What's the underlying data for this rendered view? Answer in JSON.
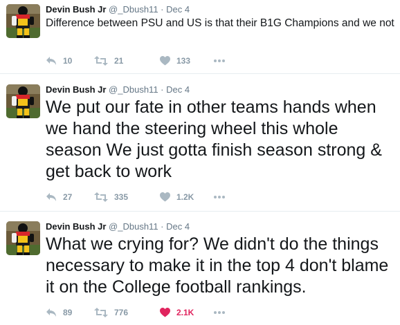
{
  "colors": {
    "text": "#14171a",
    "muted": "#657786",
    "icon": "#aab8c2",
    "like_active": "#e0245e",
    "divider": "#e6ecf0"
  },
  "tweets": [
    {
      "name": "Devin Bush Jr",
      "handle": "@_Dbush11",
      "separator": "·",
      "date": "Dec 4",
      "text": "Difference between PSU and US is that their B1G Champions and we not",
      "size": "small",
      "replies": "10",
      "retweets": "21",
      "likes": "133",
      "liked": false,
      "icons": [
        "reply-icon",
        "retweet-icon",
        "heart-icon",
        "more-icon"
      ]
    },
    {
      "name": "Devin Bush Jr",
      "handle": "@_Dbush11",
      "separator": "·",
      "date": "Dec 4",
      "text": "We put our fate in other teams hands when we hand the steering wheel this whole season We just gotta finish season strong & get back to work",
      "size": "large",
      "replies": "27",
      "retweets": "335",
      "likes": "1.2K",
      "liked": false,
      "icons": [
        "reply-icon",
        "retweet-icon",
        "heart-icon",
        "more-icon"
      ]
    },
    {
      "name": "Devin Bush Jr",
      "handle": "@_Dbush11",
      "separator": "·",
      "date": "Dec 4",
      "text": "What we crying for? We didn't do the things necessary to make it in the top 4 don't blame it on the College football rankings.",
      "size": "large",
      "replies": "89",
      "retweets": "776",
      "likes": "2.1K",
      "liked": true,
      "icons": [
        "reply-icon",
        "retweet-icon",
        "heart-icon",
        "more-icon"
      ]
    }
  ]
}
